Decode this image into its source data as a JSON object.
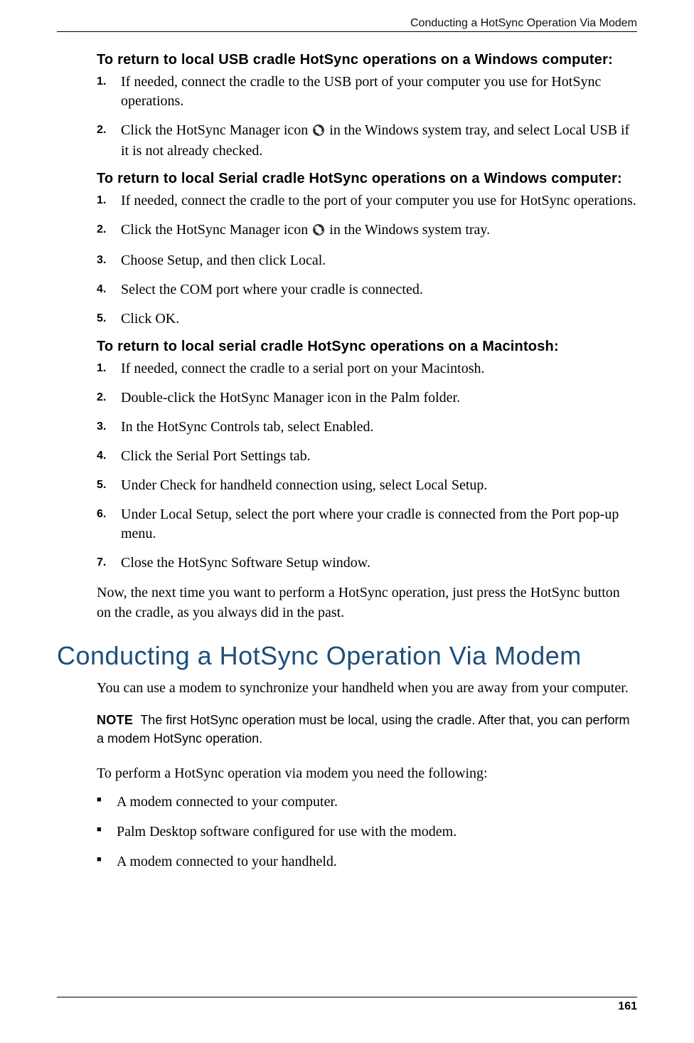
{
  "header": {
    "running_head": "Conducting a HotSync Operation Via Modem"
  },
  "procA": {
    "heading": "To return to local USB cradle HotSync operations on a Windows computer:",
    "steps": {
      "s1": "If needed, connect the cradle to the USB port of your computer you use for HotSync operations.",
      "s2a": "Click the HotSync Manager icon ",
      "s2b": " in the Windows system tray, and select Local USB if it is not already checked."
    }
  },
  "procB": {
    "heading": "To return to local Serial cradle HotSync operations on a Windows computer:",
    "steps": {
      "s1": "If needed, connect the cradle to the port of your computer you use for HotSync operations.",
      "s2a": "Click the HotSync Manager icon ",
      "s2b": " in the Windows system tray.",
      "s3": "Choose Setup, and then click Local.",
      "s4": "Select the COM port where your cradle is connected.",
      "s5": "Click OK."
    }
  },
  "procC": {
    "heading": "To return to local serial cradle HotSync operations on a Macintosh:",
    "steps": {
      "s1": "If needed, connect the cradle to a serial port on your Macintosh.",
      "s2": "Double-click the HotSync Manager icon in the Palm folder.",
      "s3": "In the HotSync Controls tab, select Enabled.",
      "s4": "Click the Serial Port Settings tab.",
      "s5": "Under Check for handheld connection using, select Local Setup.",
      "s6": "Under Local Setup, select the port where your cradle is connected from the Port pop-up menu.",
      "s7": "Close the HotSync Software Setup window."
    },
    "closing": "Now, the next time you want to perform a HotSync operation, just press the HotSync button on the cradle, as you always did in the past."
  },
  "section": {
    "title": "Conducting a HotSync Operation Via Modem",
    "intro": "You can use a modem to synchronize your handheld when you are away from your computer.",
    "note_label": "NOTE",
    "note_text": "The first HotSync operation must be local, using the cradle. After that, you can perform a modem HotSync operation.",
    "lead_in": "To perform a HotSync operation via modem you need the following:",
    "bullets": {
      "b1": "A modem connected to your computer.",
      "b2": "Palm Desktop software configured for use with the modem.",
      "b3": "A modem connected to your handheld."
    }
  },
  "footer": {
    "page_number": "161"
  },
  "icons": {
    "hotsync": "hotsync-icon"
  }
}
